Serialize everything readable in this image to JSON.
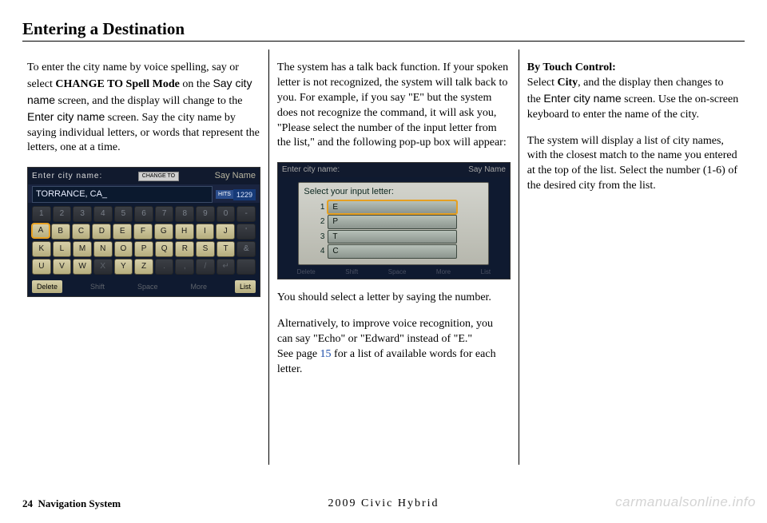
{
  "title": "Entering a Destination",
  "col1": {
    "p1_pre": "To enter the city name by voice spelling, say or select ",
    "p1_bold": "CHANGE TO Spell Mode",
    "p1_mid1": " on the ",
    "p1_sans1": "Say city name",
    "p1_mid2": " screen, and the display will change to the ",
    "p1_sans2": "Enter city name",
    "p1_end": " screen. Say the city name by saying individual letters, or words that represent the letters, one at a time."
  },
  "kbd": {
    "header": "Enter city name:",
    "change_to": "CHANGE TO",
    "sayname": "Say Name",
    "input": "TORRANCE, CA_",
    "hits_lbl": "HITS",
    "hits_val": "1229",
    "row1": [
      "1",
      "2",
      "3",
      "4",
      "5",
      "6",
      "7",
      "8",
      "9",
      "0",
      "-"
    ],
    "row2": [
      "A",
      "B",
      "C",
      "D",
      "E",
      "F",
      "G",
      "H",
      "I",
      "J",
      "'"
    ],
    "row3": [
      "K",
      "L",
      "M",
      "N",
      "O",
      "P",
      "Q",
      "R",
      "S",
      "T",
      "&"
    ],
    "row4": [
      "U",
      "V",
      "W",
      "X",
      "Y",
      "Z",
      ".",
      ",",
      "/",
      "↵",
      ""
    ],
    "bot": {
      "delete": "Delete",
      "shift": "Shift",
      "space": "Space",
      "more": "More",
      "list": "List"
    }
  },
  "col2": {
    "p1": "The system has a talk back function. If your spoken letter is not recognized, the system will talk back to you. For example, if you say \"E\" but the system does not recognize the command, it will ask you, \"Please select the number of the input letter from the list,\" and the following pop-up box will appear:",
    "p2": "You should select a letter by saying the number.",
    "p3": "Alternatively, to improve voice recognition, you can say \"Echo\" or \"Edward\" instead of \"E.\"",
    "p4a": "See page ",
    "p4link": "15",
    "p4b": " for a list of available words for each letter."
  },
  "pop": {
    "header": "Enter city name:",
    "sayname": "Say Name",
    "label": "Select your input letter:",
    "rows": [
      {
        "n": "1",
        "v": "E"
      },
      {
        "n": "2",
        "v": "P"
      },
      {
        "n": "3",
        "v": "T"
      },
      {
        "n": "4",
        "v": "C"
      }
    ],
    "bot": [
      "Delete",
      "Shift",
      "Space",
      "More",
      "List"
    ]
  },
  "col3": {
    "h": "By Touch Control:",
    "p1a": "Select ",
    "p1b": "City",
    "p1c": ", and the display then changes to the ",
    "p1sans": "Enter city name",
    "p1d": " screen. Use the on-screen keyboard to enter the name of the city.",
    "p2": "The system will display a list of city names, with the closest match to the name you entered at the top of the list. Select the number (1-6) of the desired city from the list."
  },
  "footer": {
    "page": "24",
    "label": "Navigation System"
  },
  "modelyear": "2009  Civic  Hybrid",
  "watermark": "carmanualsonline.info"
}
